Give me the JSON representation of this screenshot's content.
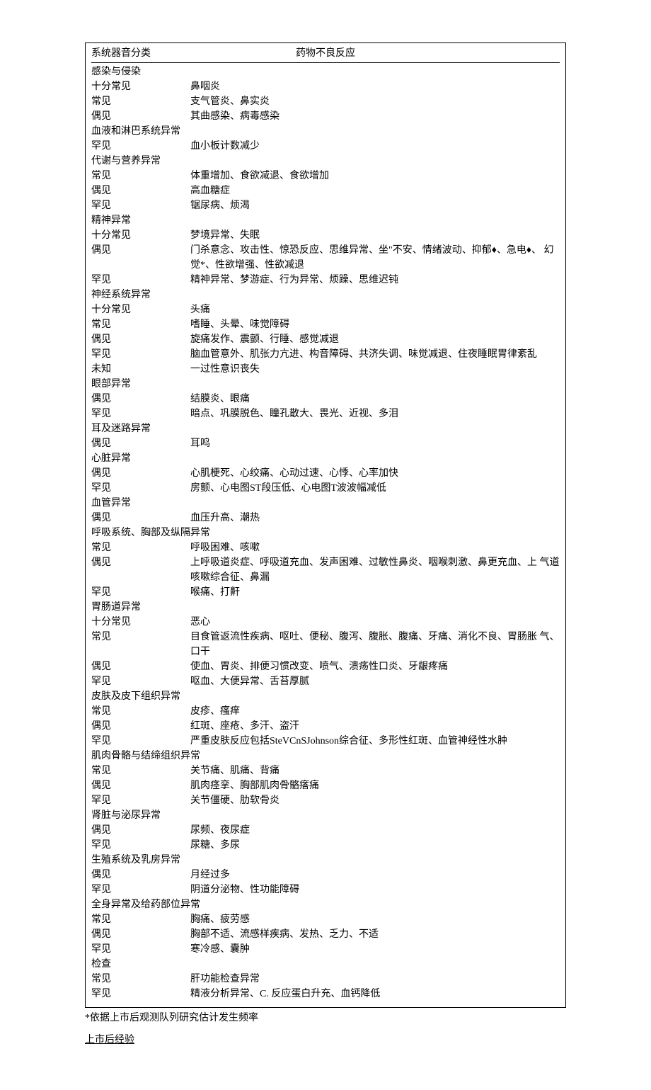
{
  "header": {
    "col1": "系统器音分类",
    "col2": "药物不良反应"
  },
  "sections": [
    {
      "category": "感染与侵染",
      "rows": [
        {
          "freq": "十分常见",
          "desc": "鼻咽炎"
        },
        {
          "freq": "常见",
          "desc": "支气管炎、鼻实炎"
        },
        {
          "freq": "偶见",
          "desc": "其曲感染、病毒感染"
        }
      ]
    },
    {
      "category": "血液和淋巴系统异常",
      "rows": [
        {
          "freq": "罕见",
          "desc": "血小板计数减少"
        }
      ]
    },
    {
      "category": "代谢与营养异常",
      "rows": [
        {
          "freq": "常见",
          "desc": "体重增加、食欲减退、食欲增加"
        },
        {
          "freq": "偶见",
          "desc": "高血糖症"
        },
        {
          "freq": "罕见",
          "desc": "锯尿病、烦渴"
        }
      ]
    },
    {
      "category": "精神异常",
      "rows": [
        {
          "freq": "十分常见",
          "desc": "梦境异常、失眠"
        },
        {
          "freq": "偶见",
          "desc": "门杀意念、攻击性、惊恐反应、思维异常、坐\"不安、情绪波动、抑郁♦、急电♦、 幻觉*、性欲增强、性欲减退"
        },
        {
          "freq": "罕见",
          "desc": "精神异常、梦游症、行为异常、烦躁、思维迟钝"
        }
      ]
    },
    {
      "category": "神经系统异常",
      "rows": [
        {
          "freq": "十分常见",
          "desc": "头痛"
        },
        {
          "freq": "常见",
          "desc": "嗜睡、头晕、味觉障碍"
        },
        {
          "freq": "偶见",
          "desc": "旋痛发作、震颤、行睡、感觉减退"
        },
        {
          "freq": "罕见",
          "desc": "脑血管意外、肌张力亢进、构音障碍、共济失调、味觉减退、住夜睡眠胃律紊乱"
        },
        {
          "freq": "未知",
          "desc": "一过性意识丧失"
        }
      ]
    },
    {
      "category": "眼部异常",
      "rows": [
        {
          "freq": "偶见",
          "desc": "结膜炎、眼痛"
        },
        {
          "freq": "罕见",
          "desc": "暗点、巩膜脱色、瞳孔散大、畏光、近视、多泪"
        }
      ]
    },
    {
      "category": "耳及迷路异常",
      "rows": [
        {
          "freq": "偶见",
          "desc": "耳鸣"
        }
      ]
    },
    {
      "category": "心脏异常",
      "rows": [
        {
          "freq": "偶见",
          "desc": "心肌梗死、心绞痛、心动过速、心悸、心率加快"
        },
        {
          "freq": "罕见",
          "desc": "房颤、心电图ST段压低、心电图T波波幅减低"
        }
      ]
    },
    {
      "category": "血管异常",
      "rows": [
        {
          "freq": "偶见",
          "desc": "血压升高、潮热"
        }
      ]
    },
    {
      "category": "呼吸系统、胸部及纵隔异常",
      "rows": [
        {
          "freq": "常见",
          "desc": "呼吸困难、咳嗽"
        },
        {
          "freq": "偶见",
          "desc": "上呼吸道炎症、呼吸道充血、发声困难、过敏性鼻炎、咽喉刺激、鼻更充血、上 气道咳嗽综合征、鼻漏"
        },
        {
          "freq": "罕见",
          "desc": "喉痛、打鼾"
        }
      ]
    },
    {
      "category": "胃肠道异常",
      "rows": [
        {
          "freq": "十分常见",
          "desc": "恶心"
        },
        {
          "freq": "常见",
          "desc": "目食管返流性疾病、呕吐、便秘、腹泻、腹胀、腹痛、牙痛、消化不良、胃肠胀 气、口干"
        },
        {
          "freq": "偶见",
          "desc": "使血、胃炎、排便习惯改变、喷气、溃疡性口炎、牙龈疼痛"
        },
        {
          "freq": "罕见",
          "desc": "呕血、大便异常、舌苔厚腻"
        }
      ]
    },
    {
      "category": "皮肤及皮下组织异常",
      "rows": [
        {
          "freq": "常见",
          "desc": "皮疹、瘙痒"
        },
        {
          "freq": "偶见",
          "desc": "红斑、座疮、多汗、盗汗"
        },
        {
          "freq": "罕见",
          "desc": "严重皮肤反应包括SteVCnSJohnson综合征、多形性红斑、血管神经性水肿"
        }
      ]
    },
    {
      "category": "肌肉骨骼与结缔组织异常",
      "rows": [
        {
          "freq": "常见",
          "desc": "关节痛、肌痛、背痛"
        },
        {
          "freq": "偶见",
          "desc": "肌肉痉挛、胸部肌肉骨骼瘩痛"
        },
        {
          "freq": "罕见",
          "desc": "关节僵硬、肋软骨炎"
        }
      ]
    },
    {
      "category": "肾脏与泌尿异常",
      "rows": [
        {
          "freq": "偶见",
          "desc": "尿频、夜尿症"
        },
        {
          "freq": "罕见",
          "desc": "尿糖、多尿"
        }
      ]
    },
    {
      "category": "生殖系统及乳房异常",
      "rows": [
        {
          "freq": "偶见",
          "desc": "月经过多"
        },
        {
          "freq": "罕见",
          "desc": "阴道分泌物、性功能障碍"
        }
      ]
    },
    {
      "category": "全身异常及给药部位异常",
      "rows": [
        {
          "freq": "常见",
          "desc": "胸痛、疲劳感"
        },
        {
          "freq": "偶见",
          "desc": "胸部不适、流感样疾病、发热、乏力、不适"
        },
        {
          "freq": "罕见",
          "desc": "寒冷感、囊肿"
        }
      ]
    },
    {
      "category": "检查",
      "rows": [
        {
          "freq": "常见",
          "desc": "肝功能检查异常"
        },
        {
          "freq": "罕见",
          "desc": "精液分析异常、C. 反应蛋白升充、血钙降低"
        }
      ]
    }
  ],
  "footnote": "*依据上市后观测队列研究估计发生频率",
  "heading": "上市后经验"
}
